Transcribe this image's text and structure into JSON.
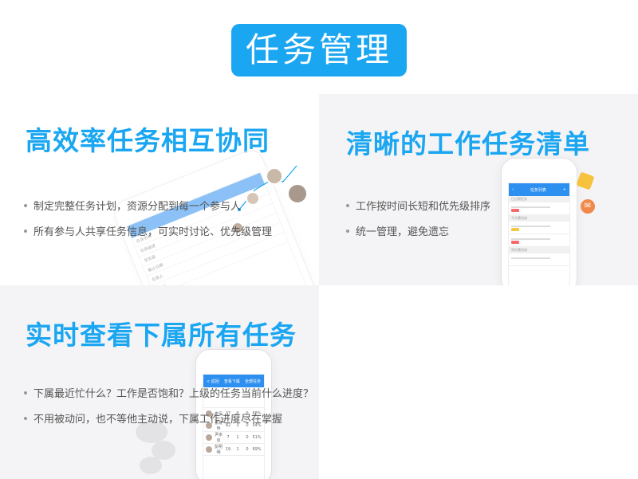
{
  "header": {
    "title": "任务管理"
  },
  "panels": [
    {
      "title": "高效率任务相互协同",
      "bullets": [
        "制定完整任务计划，资源分配到每一个参与人",
        "所有参与人共享任务信息，可实时讨论、优先级管理"
      ]
    },
    {
      "title": "清晰的工作任务清单",
      "bullets": [
        "工作按时间长短和优先级排序",
        "统一管理，避免遗忘"
      ]
    },
    {
      "title": "实时查看下属所有任务",
      "bullets": [
        "下属最近忙什么？工作是否饱和？上级的任务当前什么进度？",
        "不用被动问，也不等他主动说，下属工作进度尽在掌握"
      ]
    }
  ],
  "mock1": {
    "rows": [
      "任务名称",
      "任务描述",
      "优先级",
      "截止日期",
      "负责人",
      "参与人"
    ]
  },
  "mock2": {
    "bar_title": "任务列表",
    "sections": [
      "已过期任务",
      "今天需完成",
      "明天需完成"
    ]
  },
  "mock3": {
    "bar_left": "< 返回",
    "bar_title": "查看下属",
    "bar_right": "全部任务",
    "rows": [
      {
        "name": "李军",
        "a": "37",
        "b": "9",
        "c": "0",
        "d": "68%"
      },
      {
        "name": "张晓伟",
        "a": "82",
        "b": "3",
        "c": "0",
        "d": "54%"
      },
      {
        "name": "尹京京",
        "a": "7",
        "b": "1",
        "c": "0",
        "d": "51%"
      },
      {
        "name": "彭明明",
        "a": "19",
        "b": "1",
        "c": "0",
        "d": "69%"
      }
    ]
  },
  "colors": {
    "accent": "#1ba6f2",
    "phone_bar": "#2d8ff0",
    "panel_gray": "#f4f4f6"
  },
  "icons": [
    "star-icon",
    "chat-bubble-icon",
    "user-avatar-icon"
  ]
}
